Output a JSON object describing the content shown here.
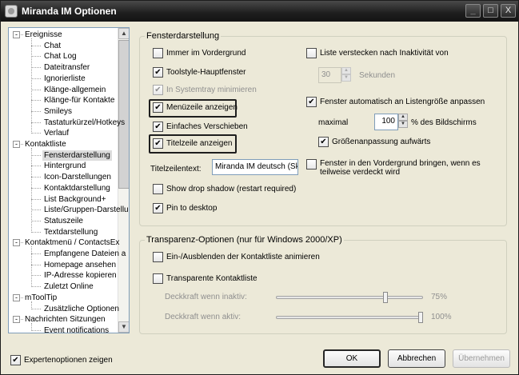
{
  "window": {
    "title": "Miranda IM Optionen",
    "controls": {
      "minimize": "_",
      "maximize": "□",
      "close": "X"
    }
  },
  "tree": {
    "items": [
      {
        "label": "Ereignisse",
        "level": 0,
        "expander": "-"
      },
      {
        "label": "Chat",
        "level": 1
      },
      {
        "label": "Chat Log",
        "level": 1
      },
      {
        "label": "Dateitransfer",
        "level": 1
      },
      {
        "label": "Ignorierliste",
        "level": 1
      },
      {
        "label": "Klänge-allgemein",
        "level": 1
      },
      {
        "label": "Klänge-für Kontakte",
        "level": 1
      },
      {
        "label": "Smileys",
        "level": 1
      },
      {
        "label": "Tastaturkürzel/Hotkeys",
        "level": 1
      },
      {
        "label": "Verlauf",
        "level": 1
      },
      {
        "label": "Kontaktliste",
        "level": 0,
        "expander": "-"
      },
      {
        "label": "Fensterdarstellung",
        "level": 1,
        "selected": true
      },
      {
        "label": "Hintergrund",
        "level": 1
      },
      {
        "label": "Icon-Darstellungen",
        "level": 1
      },
      {
        "label": "Kontaktdarstellung",
        "level": 1
      },
      {
        "label": "List Background+",
        "level": 1
      },
      {
        "label": "Liste/Gruppen-Darstellung",
        "level": 1
      },
      {
        "label": "Statuszeile",
        "level": 1
      },
      {
        "label": "Textdarstellung",
        "level": 1
      },
      {
        "label": "Kontaktmenü / ContactsEx",
        "level": 0,
        "expander": "-"
      },
      {
        "label": "Empfangene Dateien a",
        "level": 1
      },
      {
        "label": "Homepage ansehen",
        "level": 1
      },
      {
        "label": "IP-Adresse kopieren",
        "level": 1
      },
      {
        "label": "Zuletzt Online",
        "level": 1
      },
      {
        "label": "mToolTip",
        "level": 0,
        "expander": "-"
      },
      {
        "label": "Zusätzliche Optionen",
        "level": 1
      },
      {
        "label": "Nachrichten Sitzungen",
        "level": 0,
        "expander": "-"
      },
      {
        "label": "Event notifications",
        "level": 1
      }
    ],
    "scroll_up": "▲",
    "scroll_down": "▼"
  },
  "expert_mode": {
    "label": "Expertenoptionen zeigen",
    "checked": true
  },
  "check_mark": "✔",
  "window_group": {
    "legend": "Fensterdarstellung",
    "always_on_top": {
      "label": "Immer im Vordergrund",
      "checked": false
    },
    "toolstyle": {
      "label": "Toolstyle-Hauptfenster",
      "checked": true
    },
    "minimize_tray": {
      "label": "In Systemtray minimieren",
      "checked": true,
      "disabled": true
    },
    "show_menubar": {
      "label": "Menüzeile anzeigen",
      "checked": true
    },
    "simple_move": {
      "label": "Einfaches Verschieben",
      "checked": true
    },
    "show_titlebar": {
      "label": "Titelzeile anzeigen",
      "checked": true
    },
    "titlebar_text_label": "Titelzeilentext:",
    "titlebar_text_value": "Miranda IM deutsch (Sk",
    "drop_shadow": {
      "label": "Show drop shadow (restart required)",
      "checked": false
    },
    "pin_desktop": {
      "label": "Pin to desktop",
      "checked": true
    },
    "hide_inactive": {
      "label": "Liste verstecken nach Inaktivität von",
      "checked": false
    },
    "hide_seconds_value": "30",
    "hide_seconds_unit": "Sekunden",
    "auto_size": {
      "label": "Fenster automatisch an Listengröße anpassen",
      "checked": true
    },
    "max_label": "maximal",
    "max_value": "100",
    "max_unit": "% des Bildschirms",
    "size_upward": {
      "label": "Größenanpassung aufwärts",
      "checked": true
    },
    "bring_front": {
      "label": "Fenster in den Vordergrund bringen, wenn es teilweise verdeckt wird",
      "checked": false
    }
  },
  "transparency_group": {
    "legend": "Transparenz-Optionen (nur für Windows 2000/XP)",
    "fade": {
      "label": "Ein-/Ausblenden der Kontaktliste animieren",
      "checked": false
    },
    "transparent": {
      "label": "Transparente Kontaktliste",
      "checked": false
    },
    "inactive_label": "Deckkraft wenn inaktiv:",
    "inactive_value": "75%",
    "inactive_level": 0.75,
    "active_label": "Deckkraft wenn aktiv:",
    "active_value": "100%",
    "active_level": 1.0
  },
  "buttons": {
    "ok": "OK",
    "cancel": "Abbrechen",
    "apply": "Übernehmen"
  }
}
